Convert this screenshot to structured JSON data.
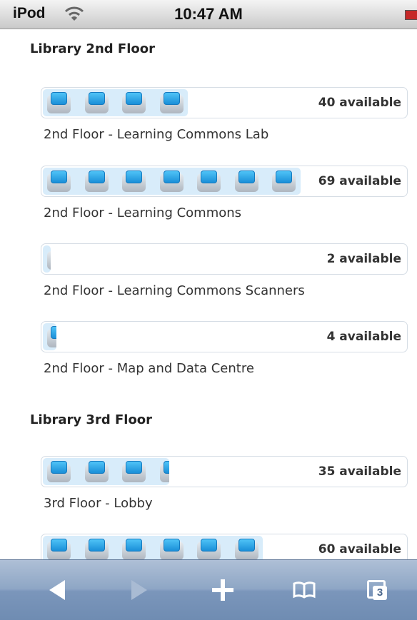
{
  "status_bar": {
    "carrier": "iPod",
    "time": "10:47 AM"
  },
  "sections": [
    {
      "title": "Library 2nd Floor",
      "labs": [
        {
          "name": "2nd Floor - Learning Commons Lab",
          "available_text": "40 available",
          "icons": 4
        },
        {
          "name": "2nd Floor - Learning Commons",
          "available_text": "69 available",
          "icons": 7
        },
        {
          "name": "2nd Floor - Learning Commons Scanners",
          "available_text": "2 available",
          "icons": 0.1
        },
        {
          "name": "2nd Floor - Map and Data Centre",
          "available_text": "4 available",
          "icons": 0.25
        }
      ]
    },
    {
      "title": "Library 3rd Floor",
      "labs": [
        {
          "name": "3rd Floor - Lobby",
          "available_text": "35 available",
          "icons": 3.5
        },
        {
          "name": "",
          "available_text": "60 available",
          "icons": 6
        }
      ]
    }
  ],
  "toolbar": {
    "tab_count": "3",
    "icons": [
      "back-arrow-icon",
      "forward-arrow-icon",
      "add-bookmark-icon",
      "bookmarks-icon",
      "tabs-icon"
    ]
  },
  "colors": {
    "bar_fill": "#d8ecfa",
    "screen_blue": "#1a8fd8",
    "toolbar": "#7b96bb"
  }
}
